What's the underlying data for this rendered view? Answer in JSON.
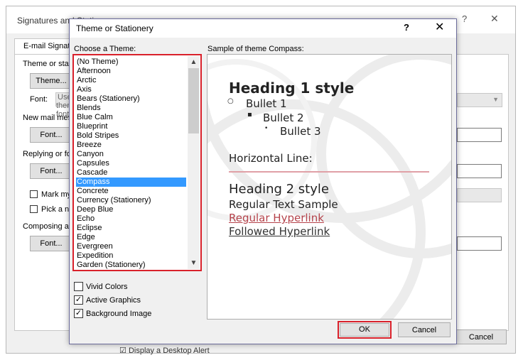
{
  "background_dialog": {
    "title": "Signatures and Stationery",
    "help": "?",
    "close": "✕",
    "tab_label": "E-mail Signature",
    "theme_label": "Theme or stationery for new HTML e-mail message",
    "theme_button": "Theme...",
    "font_label": "Font:",
    "font_value": "Use theme's font",
    "new_mail_label": "New mail messages",
    "font_button_1": "Font...",
    "replying_label": "Replying or forwarding messages",
    "font_button_2": "Font...",
    "mark_label": "Mark my comments with:",
    "pick_label": "Pick a new color when replying or forwarding",
    "composing_label": "Composing and reading plain text messages",
    "font_button_3": "Font...",
    "cancel_label": "Cancel",
    "desktop_alert": "Display a Desktop Alert"
  },
  "dialog": {
    "title": "Theme or Stationery",
    "help": "?",
    "close": "✕",
    "choose_label": "Choose a Theme:",
    "sample_label": "Sample of theme Compass:",
    "themes": [
      "(No Theme)",
      "Afternoon",
      "Arctic",
      "Axis",
      "Bears (Stationery)",
      "Blends",
      "Blue Calm",
      "Blueprint",
      "Bold Stripes",
      "Breeze",
      "Canyon",
      "Capsules",
      "Cascade",
      "Compass",
      "Concrete",
      "Currency (Stationery)",
      "Deep Blue",
      "Echo",
      "Eclipse",
      "Edge",
      "Evergreen",
      "Expedition",
      "Garden (Stationery)"
    ],
    "selected_index": 13,
    "checkboxes": [
      {
        "label": "Vivid Colors",
        "checked": false
      },
      {
        "label": "Active Graphics",
        "checked": true
      },
      {
        "label": "Background Image",
        "checked": true
      }
    ],
    "ok_label": "OK",
    "cancel_label": "Cancel"
  },
  "sample": {
    "heading1": "Heading 1 style",
    "bullet1": "Bullet 1",
    "bullet2": "Bullet 2",
    "bullet3": "Bullet 3",
    "hline_label": "Horizontal Line:",
    "heading2": "Heading 2 style",
    "regular_text": "Regular Text Sample",
    "hyperlink": "Regular Hyperlink",
    "followed": "Followed Hyperlink"
  },
  "colors": {
    "highlight_red": "#d9212b",
    "selection_blue": "#3399ff",
    "hyperlink": "#b5434b"
  }
}
